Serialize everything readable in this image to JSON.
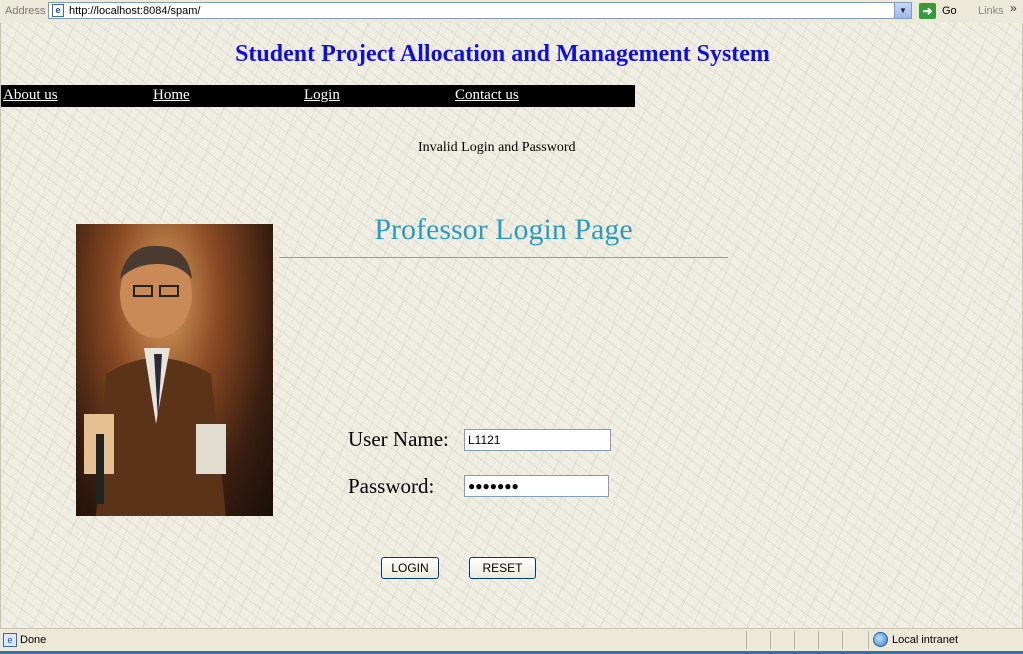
{
  "browser": {
    "address_label": "Address",
    "url": "http://localhost:8084/spam/",
    "go_label": "Go",
    "links_label": "Links"
  },
  "page": {
    "site_title": "Student Project Allocation and Management System",
    "nav": [
      "About us",
      "Home",
      "Login",
      "Contact us"
    ],
    "message": "Invalid Login and Password",
    "heading": "Professor Login Page",
    "form": {
      "username_label": "User Name:",
      "username_value": "L1121",
      "password_label": "Password:",
      "password_value": "●●●●●●●",
      "login_button": "LOGIN",
      "reset_button": "RESET"
    }
  },
  "status": {
    "text": "Done",
    "zone": "Local intranet"
  },
  "colors": {
    "site_title": "#1010d8",
    "heading": "#2a9cc0",
    "nav_bg": "#000000"
  }
}
